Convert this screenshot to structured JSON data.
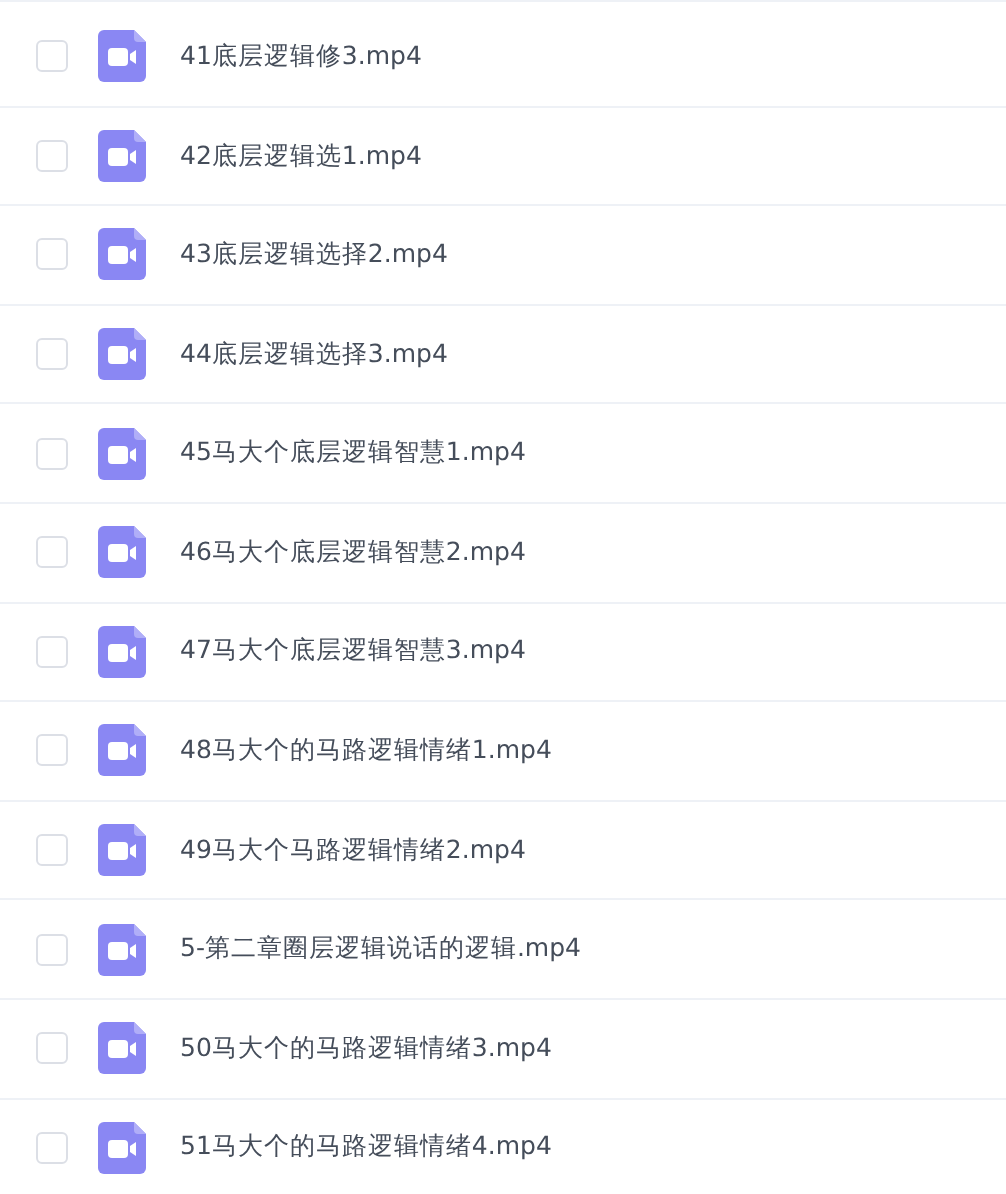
{
  "files": [
    {
      "name": "41底层逻辑修3.mp4",
      "checked": false
    },
    {
      "name": "42底层逻辑选1.mp4",
      "checked": false
    },
    {
      "name": "43底层逻辑选择2.mp4",
      "checked": false
    },
    {
      "name": "44底层逻辑选择3.mp4",
      "checked": false
    },
    {
      "name": "45马大个底层逻辑智慧1.mp4",
      "checked": false
    },
    {
      "name": "46马大个底层逻辑智慧2.mp4",
      "checked": false
    },
    {
      "name": "47马大个底层逻辑智慧3.mp4",
      "checked": false
    },
    {
      "name": "48马大个的马路逻辑情绪1.mp4",
      "checked": false
    },
    {
      "name": "49马大个马路逻辑情绪2.mp4",
      "checked": false
    },
    {
      "name": "5-第二章圈层逻辑说话的逻辑.mp4",
      "checked": false
    },
    {
      "name": "50马大个的马路逻辑情绪3.mp4",
      "checked": false
    },
    {
      "name": "51马大个的马路逻辑情绪4.mp4",
      "checked": false
    }
  ]
}
